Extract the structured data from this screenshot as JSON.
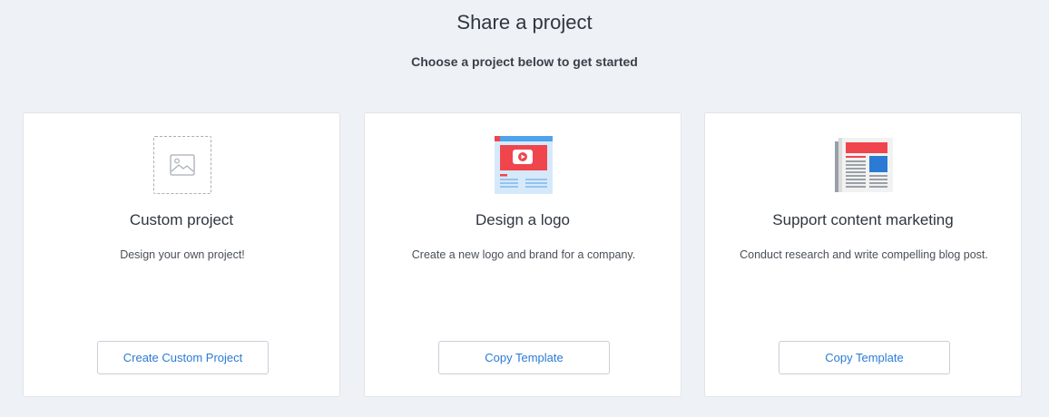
{
  "header": {
    "title": "Share a project",
    "subtitle": "Choose a project below to get started"
  },
  "cards": [
    {
      "icon": "image-placeholder-icon",
      "title": "Custom project",
      "description": "Design your own project!",
      "button_label": "Create Custom Project"
    },
    {
      "icon": "video-webpage-icon",
      "title": "Design a logo",
      "description": "Create a new logo and brand for a company.",
      "button_label": "Copy Template"
    },
    {
      "icon": "newspaper-icon",
      "title": "Support content marketing",
      "description": "Conduct research and write compelling blog post.",
      "button_label": "Copy Template"
    }
  ],
  "colors": {
    "background": "#eef1f5",
    "card": "#ffffff",
    "link_blue": "#2b7bd4",
    "accent_red": "#f0454c"
  }
}
